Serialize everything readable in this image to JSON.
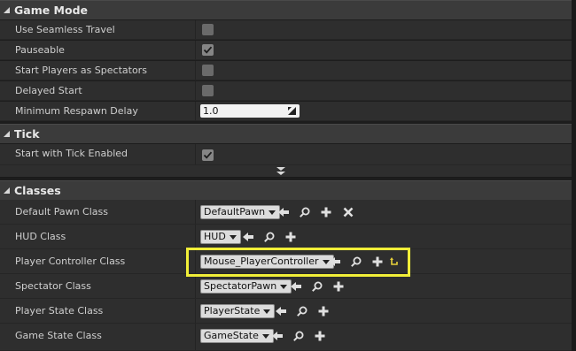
{
  "game_mode": {
    "title": "Game Mode",
    "rows": [
      {
        "label": "Use Seamless Travel",
        "checked": false
      },
      {
        "label": "Pauseable",
        "checked": true
      },
      {
        "label": "Start Players as Spectators",
        "checked": false
      },
      {
        "label": "Delayed Start",
        "checked": false
      },
      {
        "label": "Minimum Respawn Delay",
        "value": "1.0"
      }
    ]
  },
  "tick": {
    "title": "Tick",
    "rows": [
      {
        "label": "Start with Tick Enabled",
        "checked": true
      }
    ]
  },
  "classes": {
    "title": "Classes",
    "rows": [
      {
        "label": "Default Pawn Class",
        "value": "DefaultPawn",
        "icons": [
          "back-arrow-icon",
          "browse-icon",
          "add-icon",
          "clear-icon"
        ]
      },
      {
        "label": "HUD Class",
        "value": "HUD",
        "icons": [
          "back-arrow-icon",
          "browse-icon",
          "add-icon"
        ]
      },
      {
        "label": "Player Controller Class",
        "value": "Mouse_PlayerController",
        "icons": [
          "back-arrow-icon",
          "browse-icon",
          "add-icon",
          "reset-icon"
        ],
        "highlighted": true
      },
      {
        "label": "Spectator Class",
        "value": "SpectatorPawn",
        "icons": [
          "back-arrow-icon",
          "browse-icon",
          "add-icon"
        ]
      },
      {
        "label": "Player State Class",
        "value": "PlayerState",
        "icons": [
          "back-arrow-icon",
          "browse-icon",
          "add-icon"
        ]
      },
      {
        "label": "Game State Class",
        "value": "GameState",
        "icons": [
          "back-arrow-icon",
          "browse-icon",
          "add-icon"
        ]
      }
    ]
  },
  "colors": {
    "highlight": "#f1ee38",
    "panel_bg": "#2e2e2e",
    "header_bg": "#3b3b3b"
  }
}
